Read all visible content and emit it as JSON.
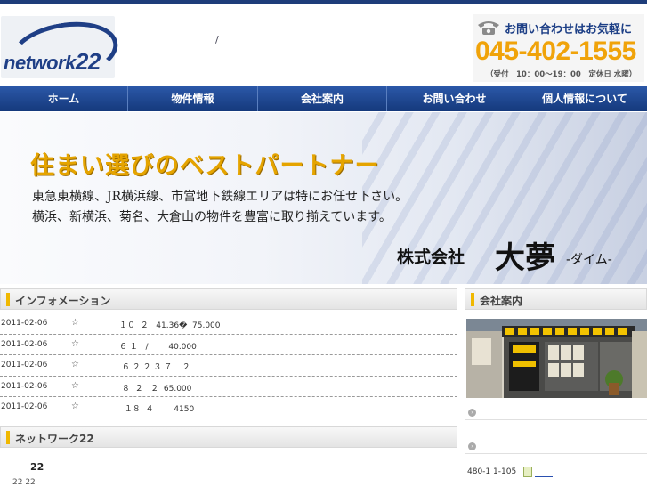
{
  "header": {
    "logo_text": "network",
    "logo_num": "22",
    "separator": "/",
    "contact_cta": "お問い合わせはお気軽に",
    "phone": "045-402-1555",
    "hours": "（受付　10：00〜19：00　定休日 水曜）"
  },
  "nav": {
    "items": [
      {
        "label": "ホーム"
      },
      {
        "label": "物件情報"
      },
      {
        "label": "会社案内"
      },
      {
        "label": "お問い合わせ"
      },
      {
        "label": "個人情報について"
      }
    ]
  },
  "hero": {
    "tagline": "住まい選びのベストパートナー",
    "line1": "東急東横線、JR横浜線、市営地下鉄線エリアは特にお任せ下さい。",
    "line2": "横浜、新横浜、菊名、大倉山の物件を豊富に取り揃えています。",
    "company_prefix": "株式会社",
    "company_name": "大夢",
    "company_reading": "-ダイム-"
  },
  "information": {
    "title": "インフォメーション",
    "rows": [
      {
        "date": "2011-02-06",
        "star": "☆",
        "text": "１０  ２   41.36�  75.000"
      },
      {
        "date": "2011-02-06",
        "star": "☆",
        "text": "６ １   /        40.000"
      },
      {
        "date": "2011-02-06",
        "star": "☆",
        "text": " ６ ２ ２ ３ ７    ２"
      },
      {
        "date": "2011-02-06",
        "star": "☆",
        "text": " ８  ２   ２  65.000"
      },
      {
        "date": "2011-02-06",
        "star": "☆",
        "text": "  １８  ４        4150"
      }
    ]
  },
  "network": {
    "title": "ネットワーク22",
    "number": "22",
    "sub": "22    22"
  },
  "sidebar": {
    "title": "会社案内",
    "arrow": "›",
    "address": "480-1 1-105"
  },
  "colors": {
    "brand_blue": "#1f3f86",
    "phone_orange": "#f0a30a",
    "tagline_gold": "#e5a400",
    "accent_bar": "#f0b800"
  }
}
